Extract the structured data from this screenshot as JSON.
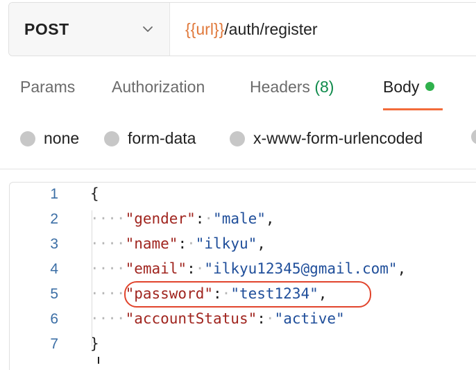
{
  "request": {
    "method": "POST",
    "url_variable": "{{url}}",
    "url_path": "/auth/register"
  },
  "tabs": [
    {
      "label": "Params"
    },
    {
      "label": "Authorization"
    },
    {
      "label": "Headers",
      "count": "(8)"
    },
    {
      "label": "Body",
      "active": true
    }
  ],
  "body_types": [
    "none",
    "form-data",
    "x-www-form-urlencoded"
  ],
  "editor": {
    "line_numbers": [
      "1",
      "2",
      "3",
      "4",
      "5",
      "6",
      "7"
    ],
    "indent_dots": "····",
    "open_brace": "{",
    "close_brace": "}",
    "fields": [
      {
        "key": "\"gender\"",
        "value": "\"male\"",
        "trail": ","
      },
      {
        "key": "\"name\"",
        "value": "\"ilkyu\"",
        "trail": ","
      },
      {
        "key": "\"email\"",
        "value": "\"ilkyu12345@gmail.com\"",
        "trail": ","
      },
      {
        "key": "\"password\"",
        "value": "\"test1234\"",
        "trail": ","
      },
      {
        "key": "\"accountStatus\"",
        "value": "\"active\"",
        "trail": ""
      }
    ],
    "colon": ":",
    "space_dot": "·"
  },
  "colors": {
    "accent": "#f26b3a",
    "variable": "#e0783a",
    "json_key": "#a0251f",
    "json_string": "#1f4e9a",
    "status_dot": "#2fb14c",
    "annotation": "#e1442c"
  }
}
